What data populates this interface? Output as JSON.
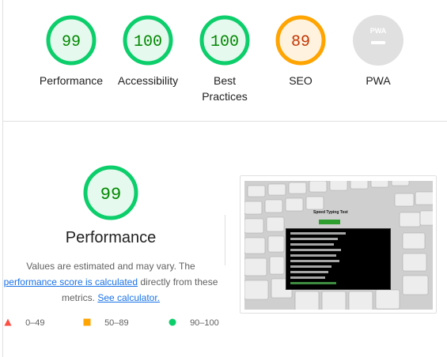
{
  "scores": [
    {
      "id": "performance",
      "value": "99",
      "label": "Performance",
      "status": "pass"
    },
    {
      "id": "accessibility",
      "value": "100",
      "label": "Accessibility",
      "status": "pass"
    },
    {
      "id": "best-practices",
      "value": "100",
      "label": "Best Practices",
      "status": "pass"
    },
    {
      "id": "seo",
      "value": "89",
      "label": "SEO",
      "status": "average"
    },
    {
      "id": "pwa",
      "value": "PWA",
      "label": "PWA",
      "status": "na"
    }
  ],
  "performance_detail": {
    "score": "99",
    "title": "Performance",
    "desc_prefix": "Values are estimated and may vary. The ",
    "desc_link1": "performance score is calculated",
    "desc_middle": " directly from these metrics. ",
    "desc_link2": "See calculator."
  },
  "legend": [
    {
      "range": "0–49",
      "shape": "triangle",
      "color": "#ff4e42"
    },
    {
      "range": "50–89",
      "shape": "square",
      "color": "#ffa400"
    },
    {
      "range": "90–100",
      "shape": "circle",
      "color": "#0cce6b"
    }
  ],
  "colors": {
    "pass_ring": "#0cce6b",
    "pass_fill": "#e6f9ee",
    "pass_text": "#008800",
    "avg_ring": "#ffa400",
    "avg_fill": "#fff3e0",
    "avg_text": "#c33300",
    "na_fill": "#e0e0e0",
    "na_text": "#ffffff"
  },
  "screenshot": {
    "site_title": "Speed Typing Test"
  }
}
